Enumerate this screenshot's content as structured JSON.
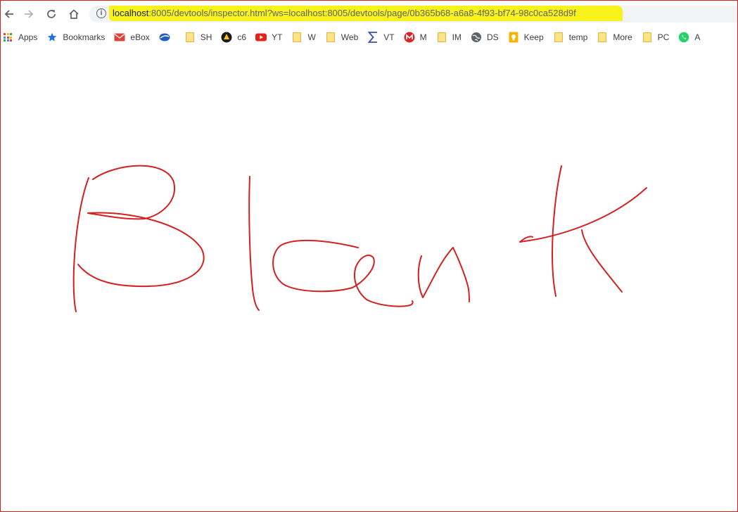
{
  "browser": {
    "url_host": "localhost",
    "url_rest": ":8005/devtools/inspector.html?ws=localhost:8005/devtools/page/0b365b68-a6a8-4f93-bf74-98c0ca528d9f"
  },
  "bookmarks": [
    {
      "label": "Apps",
      "icon": "apps-grid-icon"
    },
    {
      "label": "Bookmarks",
      "icon": "star-icon"
    },
    {
      "label": "eBox",
      "icon": "mail-icon"
    },
    {
      "label": "",
      "icon": "swirl-logo-icon"
    },
    {
      "label": "SH",
      "icon": "folder-icon"
    },
    {
      "label": "c6",
      "icon": "c6-logo-icon"
    },
    {
      "label": "YT",
      "icon": "youtube-icon"
    },
    {
      "label": "W",
      "icon": "folder-icon"
    },
    {
      "label": "Web",
      "icon": "folder-icon"
    },
    {
      "label": "VT",
      "icon": "sigma-icon"
    },
    {
      "label": "M",
      "icon": "m-logo-icon"
    },
    {
      "label": "IM",
      "icon": "folder-icon"
    },
    {
      "label": "DS",
      "icon": "globe-icon"
    },
    {
      "label": "Keep",
      "icon": "keep-icon"
    },
    {
      "label": "temp",
      "icon": "folder-icon"
    },
    {
      "label": "More",
      "icon": "folder-icon"
    },
    {
      "label": "PC",
      "icon": "folder-icon"
    },
    {
      "label": "A",
      "icon": "whatsapp-icon"
    }
  ],
  "drawing": {
    "text": "Blank",
    "stroke_color": "#d42020"
  },
  "colors": {
    "url_highlight": "#f6f21a",
    "frame_border": "#d42020"
  }
}
